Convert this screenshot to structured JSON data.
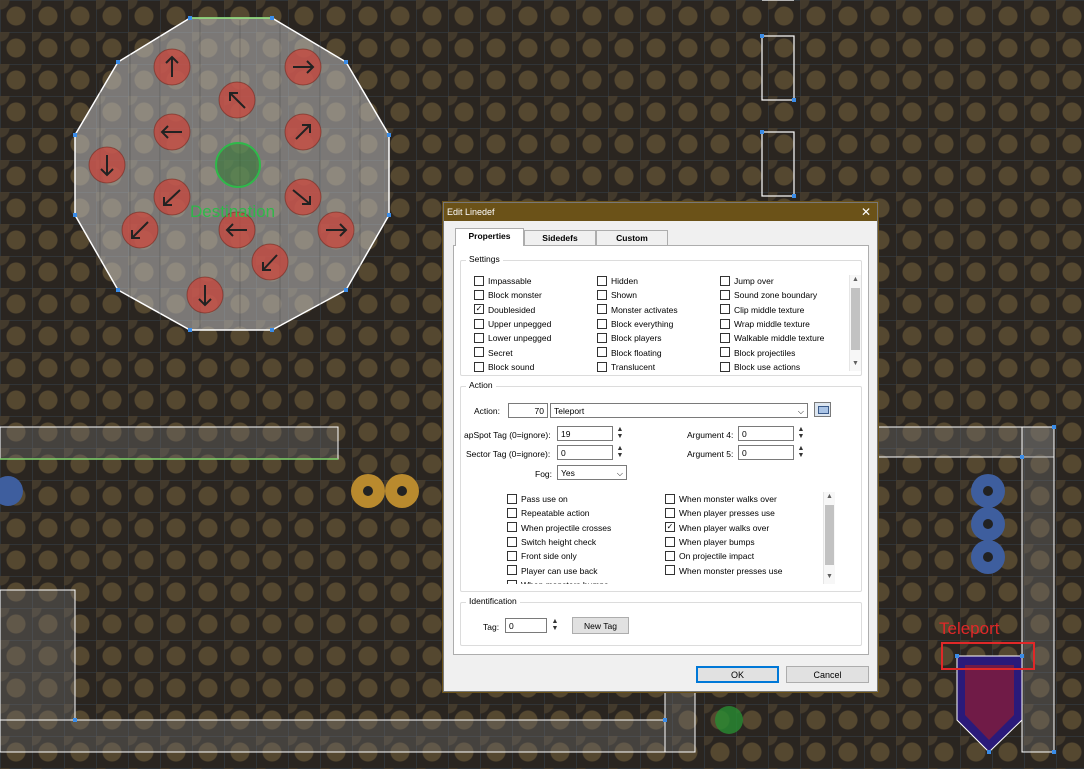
{
  "map": {
    "destination_label": "Destination",
    "teleport_label": "Teleport",
    "colors": {
      "destination": "#2fb84a",
      "teleport": "#e02828",
      "linedef": "#ffffff",
      "vertex": "#3a8ce8"
    }
  },
  "dialog": {
    "title": "Edit Linedef",
    "close_icon": "close-icon",
    "tabs": [
      "Properties",
      "Sidedefs",
      "Custom"
    ],
    "active_tab": "Properties",
    "settings": {
      "title": "Settings",
      "flags": [
        {
          "label": "Impassable",
          "checked": false
        },
        {
          "label": "Block monster",
          "checked": false
        },
        {
          "label": "Doublesided",
          "checked": true
        },
        {
          "label": "Upper unpegged",
          "checked": false
        },
        {
          "label": "Lower unpegged",
          "checked": false
        },
        {
          "label": "Secret",
          "checked": false
        },
        {
          "label": "Block sound",
          "checked": false
        },
        {
          "label": "Hidden",
          "checked": false
        },
        {
          "label": "Shown",
          "checked": false
        },
        {
          "label": "Monster activates",
          "checked": false
        },
        {
          "label": "Block everything",
          "checked": false
        },
        {
          "label": "Block players",
          "checked": false
        },
        {
          "label": "Block floating",
          "checked": false
        },
        {
          "label": "Translucent",
          "checked": false
        },
        {
          "label": "Jump over",
          "checked": false
        },
        {
          "label": "Sound zone boundary",
          "checked": false
        },
        {
          "label": "Clip middle texture",
          "checked": false
        },
        {
          "label": "Wrap middle texture",
          "checked": false
        },
        {
          "label": "Walkable middle texture",
          "checked": false
        },
        {
          "label": "Block projectiles",
          "checked": false
        },
        {
          "label": "Block use actions",
          "checked": false
        }
      ]
    },
    "action": {
      "title": "Action",
      "action_label": "Action:",
      "action_number": "70",
      "action_name": "Teleport",
      "arg1_label": "apSpot Tag (0=ignore):",
      "arg1_value": "19",
      "arg2_label": "Sector Tag (0=ignore):",
      "arg2_value": "0",
      "fog_label": "Fog:",
      "fog_value": "Yes",
      "arg4_label": "Argument 4:",
      "arg4_value": "0",
      "arg5_label": "Argument 5:",
      "arg5_value": "0",
      "activations": [
        {
          "label": "Pass use on",
          "checked": false
        },
        {
          "label": "Repeatable action",
          "checked": false
        },
        {
          "label": "When projectile crosses",
          "checked": false
        },
        {
          "label": "Switch height check",
          "checked": false
        },
        {
          "label": "Front side only",
          "checked": false
        },
        {
          "label": "Player can use back",
          "checked": false
        },
        {
          "label": "When monsters bumps",
          "checked": false
        },
        {
          "label": "When monster walks over",
          "checked": false
        },
        {
          "label": "When player presses use",
          "checked": false
        },
        {
          "label": "When player walks over",
          "checked": true
        },
        {
          "label": "When player bumps",
          "checked": false
        },
        {
          "label": "On projectile impact",
          "checked": false
        },
        {
          "label": "When monster presses use",
          "checked": false
        }
      ]
    },
    "identification": {
      "title": "Identification",
      "tag_label": "Tag:",
      "tag_value": "0",
      "new_tag_label": "New Tag"
    },
    "ok_label": "OK",
    "cancel_label": "Cancel"
  }
}
